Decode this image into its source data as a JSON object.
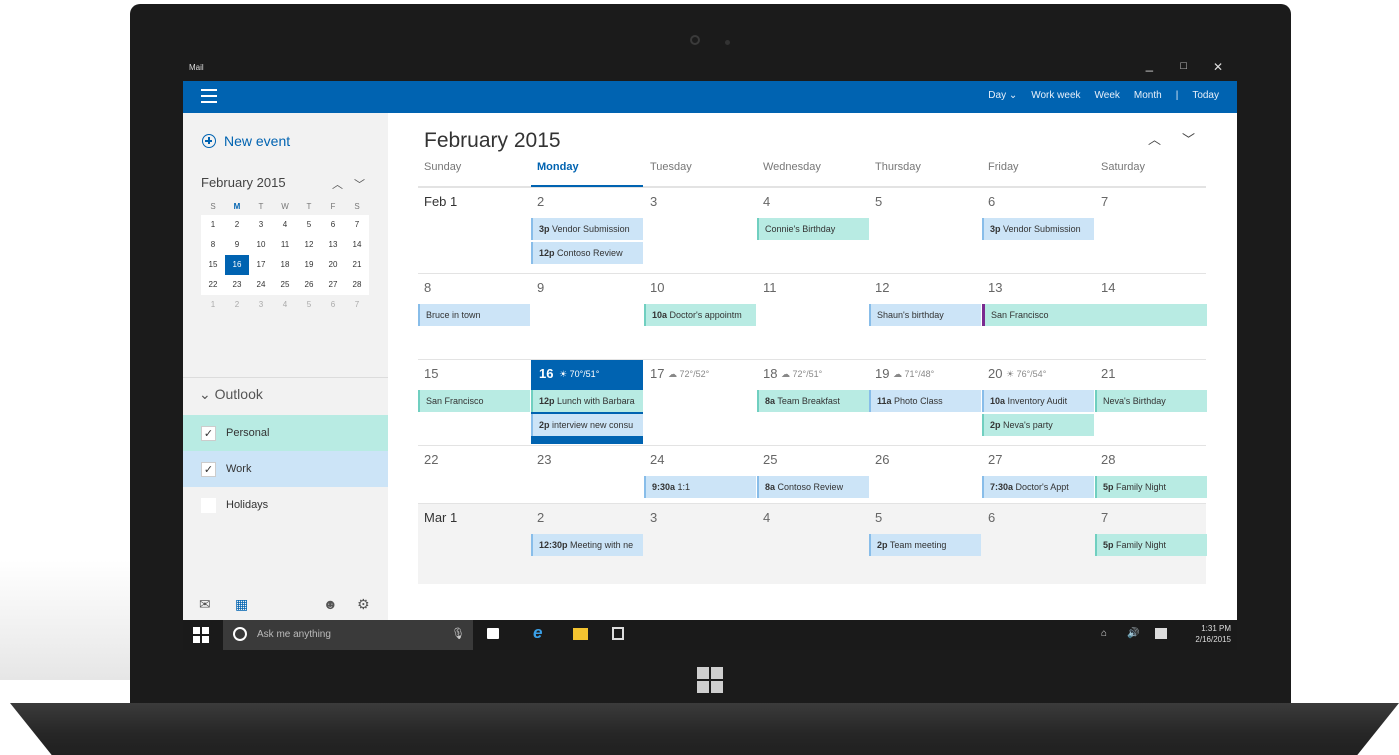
{
  "window": {
    "app_title": "Mail",
    "controls": [
      "_",
      "□",
      "✕"
    ]
  },
  "nav": {
    "views": [
      "Day ⌄",
      "Work week",
      "Week",
      "Month",
      "|",
      "Today"
    ],
    "new_event": "New event"
  },
  "mini_calendar": {
    "title": "February 2015",
    "dow": [
      "S",
      "M",
      "T",
      "W",
      "T",
      "F",
      "S"
    ],
    "rows": [
      [
        "1",
        "2",
        "3",
        "4",
        "5",
        "6",
        "7"
      ],
      [
        "8",
        "9",
        "10",
        "11",
        "12",
        "13",
        "14"
      ],
      [
        "15",
        "16",
        "17",
        "18",
        "19",
        "20",
        "21"
      ],
      [
        "22",
        "23",
        "24",
        "25",
        "26",
        "27",
        "28"
      ],
      [
        "1",
        "2",
        "3",
        "4",
        "5",
        "6",
        "7"
      ]
    ],
    "today": "16"
  },
  "calendars": {
    "header": "⌄ Outlook",
    "items": [
      {
        "label": "Personal",
        "checked": true,
        "color": "#b8ebe3"
      },
      {
        "label": "Work",
        "checked": true,
        "color": "#cce4f7"
      },
      {
        "label": "Holidays",
        "checked": false,
        "color": "#f2f2f2"
      }
    ]
  },
  "main": {
    "month_title": "February 2015",
    "dow": [
      "Sunday",
      "Monday",
      "Tuesday",
      "Wednesday",
      "Thursday",
      "Friday",
      "Saturday"
    ],
    "current_dow": "Monday",
    "weeks": [
      {
        "days": [
          "Feb 1",
          "2",
          "3",
          "4",
          "5",
          "6",
          "7"
        ],
        "events": [
          {
            "day": 1,
            "slot": 0,
            "time": "3p",
            "title": "Vendor Submission",
            "kind": "blue"
          },
          {
            "day": 1,
            "slot": 1,
            "time": "12p",
            "title": "Contoso Review",
            "kind": "blue"
          },
          {
            "day": 3,
            "slot": 0,
            "time": "",
            "title": "Connie's Birthday",
            "kind": "teal"
          },
          {
            "day": 5,
            "slot": 0,
            "time": "3p",
            "title": "Vendor Submission",
            "kind": "blue"
          }
        ]
      },
      {
        "days": [
          "8",
          "9",
          "10",
          "11",
          "12",
          "13",
          "14"
        ],
        "events": [
          {
            "day": 0,
            "slot": 0,
            "time": "",
            "title": "Bruce in town",
            "kind": "blue"
          },
          {
            "day": 2,
            "slot": 0,
            "time": "10a",
            "title": "Doctor's appointm",
            "kind": "teal"
          },
          {
            "day": 4,
            "slot": 0,
            "time": "",
            "title": "Shaun's birthday",
            "kind": "blue"
          },
          {
            "day": 5,
            "slot": 0,
            "span": 2,
            "time": "",
            "title": "San Francisco",
            "kind": "teal-purple"
          }
        ]
      },
      {
        "days": [
          "15",
          "16",
          "17",
          "18",
          "19",
          "20",
          "21"
        ],
        "weather": [
          "",
          "☀ 70°/51°",
          "☁ 72°/52°",
          "☁ 72°/51°",
          "☁ 71°/48°",
          "☀ 76°/54°",
          ""
        ],
        "events": [
          {
            "day": 0,
            "slot": 0,
            "time": "",
            "title": "San Francisco",
            "kind": "teal"
          },
          {
            "day": 1,
            "slot": 0,
            "time": "12p",
            "title": "Lunch with Barbara",
            "kind": "teal"
          },
          {
            "day": 1,
            "slot": 1,
            "time": "2p",
            "title": "interview new consu",
            "kind": "blue"
          },
          {
            "day": 3,
            "slot": 0,
            "time": "8a",
            "title": "Team Breakfast",
            "kind": "teal"
          },
          {
            "day": 4,
            "slot": 0,
            "time": "11a",
            "title": "Photo Class",
            "kind": "blue"
          },
          {
            "day": 5,
            "slot": 0,
            "time": "10a",
            "title": "Inventory Audit",
            "kind": "blue"
          },
          {
            "day": 5,
            "slot": 1,
            "time": "2p",
            "title": "Neva's party",
            "kind": "teal"
          },
          {
            "day": 6,
            "slot": 0,
            "time": "",
            "title": "Neva's Birthday",
            "kind": "teal"
          }
        ]
      },
      {
        "days": [
          "22",
          "23",
          "24",
          "25",
          "26",
          "27",
          "28"
        ],
        "events": [
          {
            "day": 2,
            "slot": 0,
            "time": "9:30a",
            "title": "1:1",
            "kind": "blue"
          },
          {
            "day": 3,
            "slot": 0,
            "time": "8a",
            "title": "Contoso Review",
            "kind": "blue"
          },
          {
            "day": 5,
            "slot": 0,
            "time": "7:30a",
            "title": "Doctor's Appt",
            "kind": "blue"
          },
          {
            "day": 6,
            "slot": 0,
            "time": "5p",
            "title": "Family Night",
            "kind": "teal"
          }
        ]
      },
      {
        "days": [
          "Mar 1",
          "2",
          "3",
          "4",
          "5",
          "6",
          "7"
        ],
        "events": [
          {
            "day": 1,
            "slot": 0,
            "time": "12:30p",
            "title": "Meeting with ne",
            "kind": "blue"
          },
          {
            "day": 4,
            "slot": 0,
            "time": "2p",
            "title": "Team meeting",
            "kind": "blue"
          },
          {
            "day": 6,
            "slot": 0,
            "time": "5p",
            "title": "Family Night",
            "kind": "teal"
          }
        ]
      }
    ]
  },
  "taskbar": {
    "search_placeholder": "Ask me anything",
    "time": "1:31 PM",
    "date": "2/16/2015"
  },
  "colors": {
    "accent": "#0063b1",
    "work": "#cce4f7",
    "personal": "#b8ebe3",
    "highlight": "#7a2b8f"
  }
}
